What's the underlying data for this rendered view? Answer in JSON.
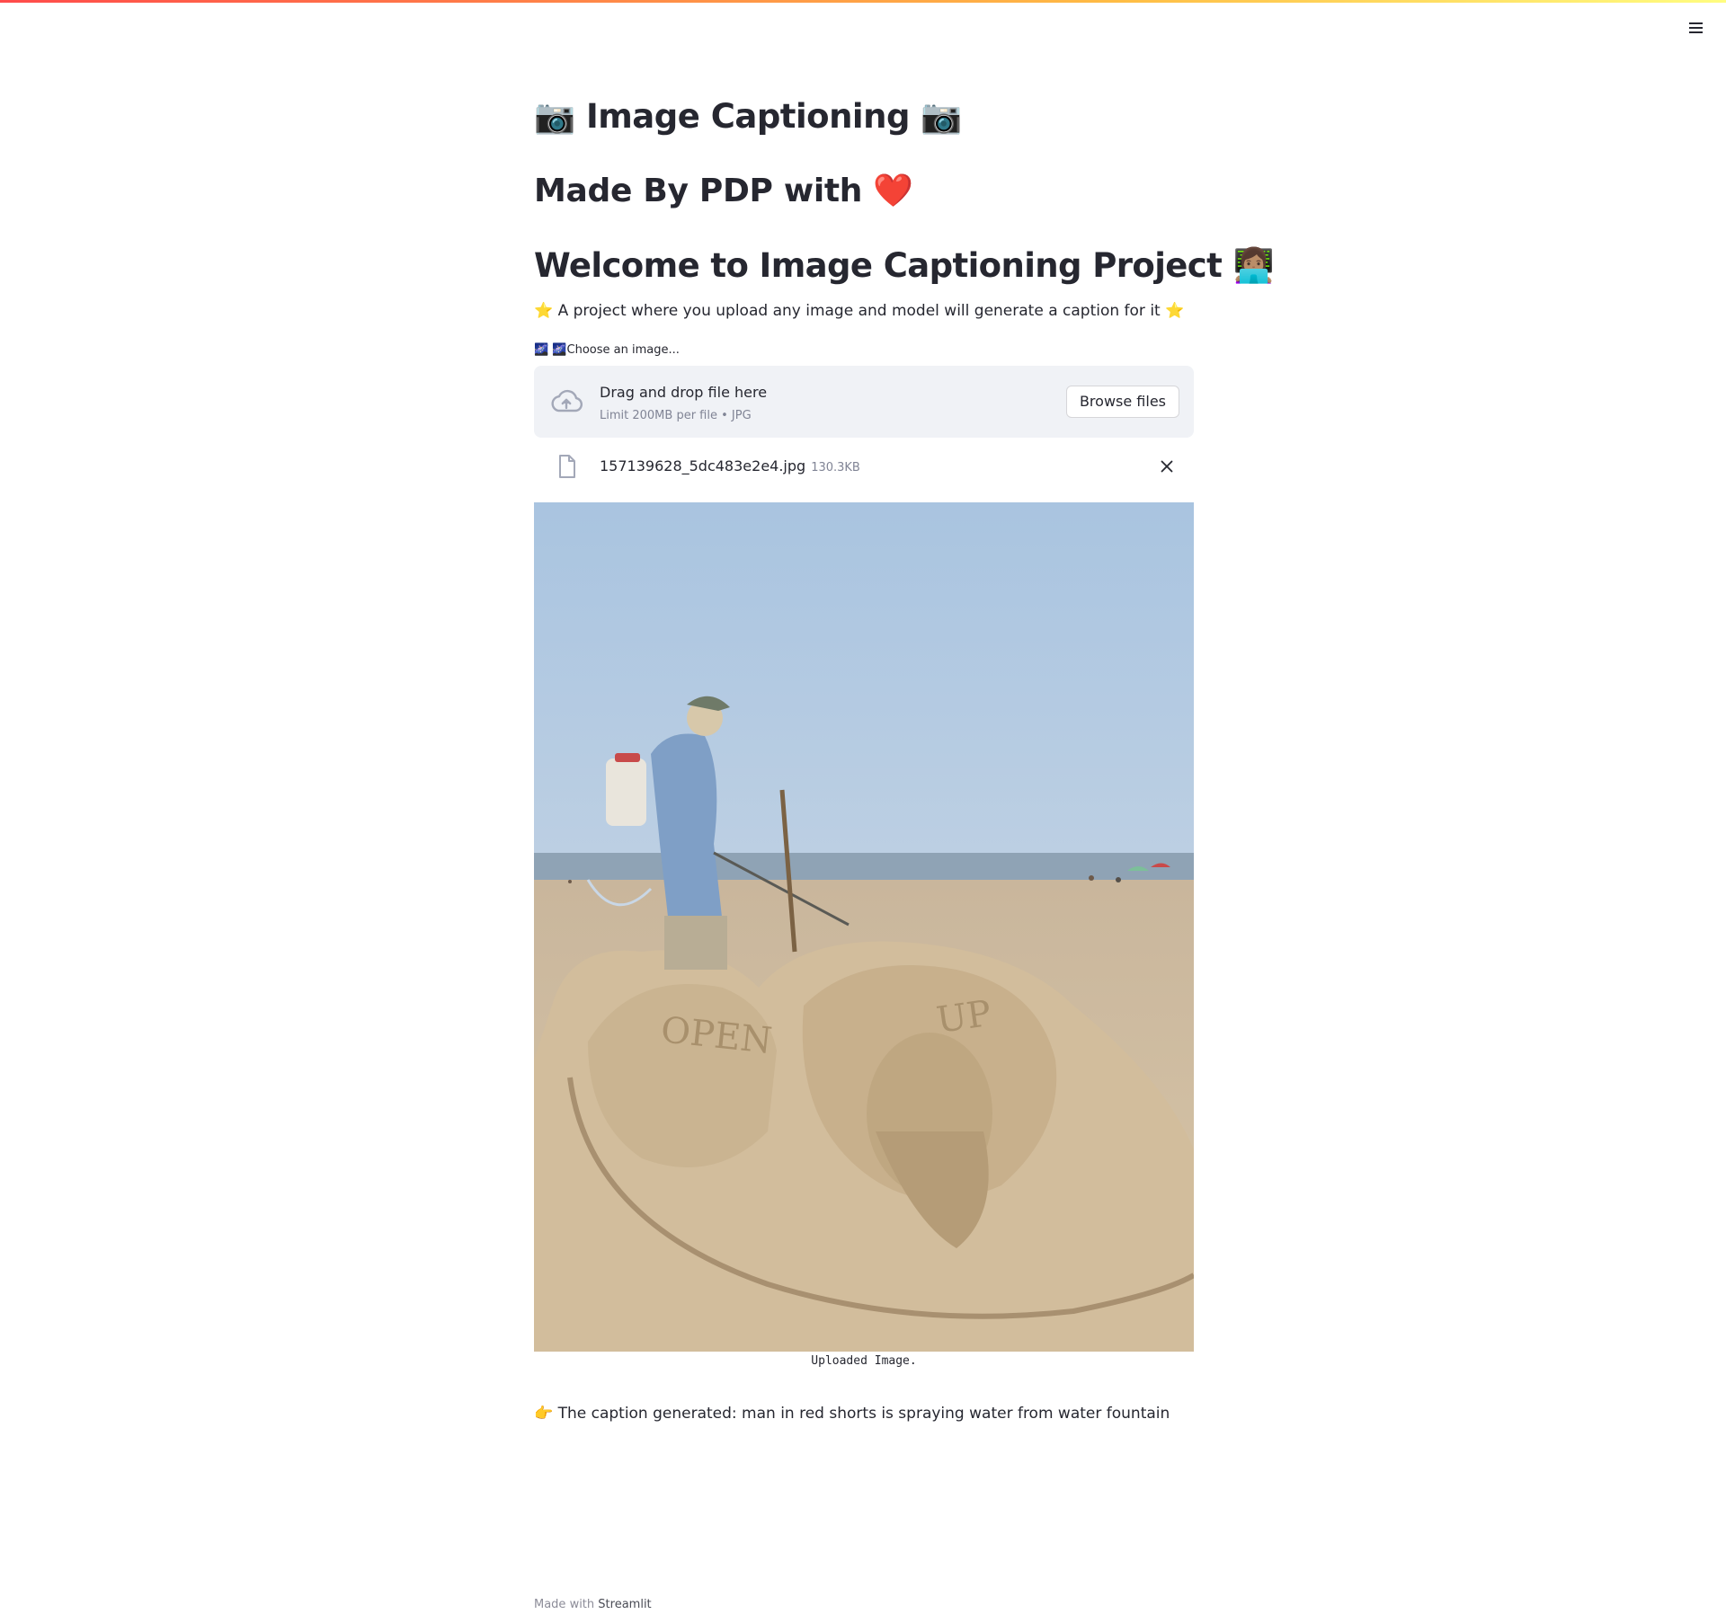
{
  "header": {
    "menu_icon": "hamburger-menu-icon"
  },
  "title": "📷 Image Captioning 📷",
  "subtitle": "Made By PDP with ❤️",
  "welcome": "Welcome to Image Captioning Project 👩🏽‍💻",
  "tagline": "⭐ A project where you upload any image and model will generate a caption for it ⭐",
  "uploader": {
    "label": "🌌 🌌Choose an image...",
    "drop_text": "Drag and drop file here",
    "limit_text": "Limit 200MB per file • JPG",
    "browse_label": "Browse files",
    "icon": "cloud-upload-icon"
  },
  "file": {
    "name": "157139628_5dc483e2e4.jpg",
    "size": "130.3KB",
    "icon": "file-icon",
    "remove_icon": "close-icon"
  },
  "image": {
    "caption": "Uploaded Image."
  },
  "result": "👉 The caption generated: man in red shorts is spraying water from water fountain",
  "footer": {
    "prefix": "Made with",
    "brand": "Streamlit"
  },
  "colors": {
    "text": "#262730",
    "muted": "#808495",
    "dropzone_bg": "#f0f2f6",
    "accent_start": "#ff4b4b",
    "accent_end": "#fffd80"
  }
}
